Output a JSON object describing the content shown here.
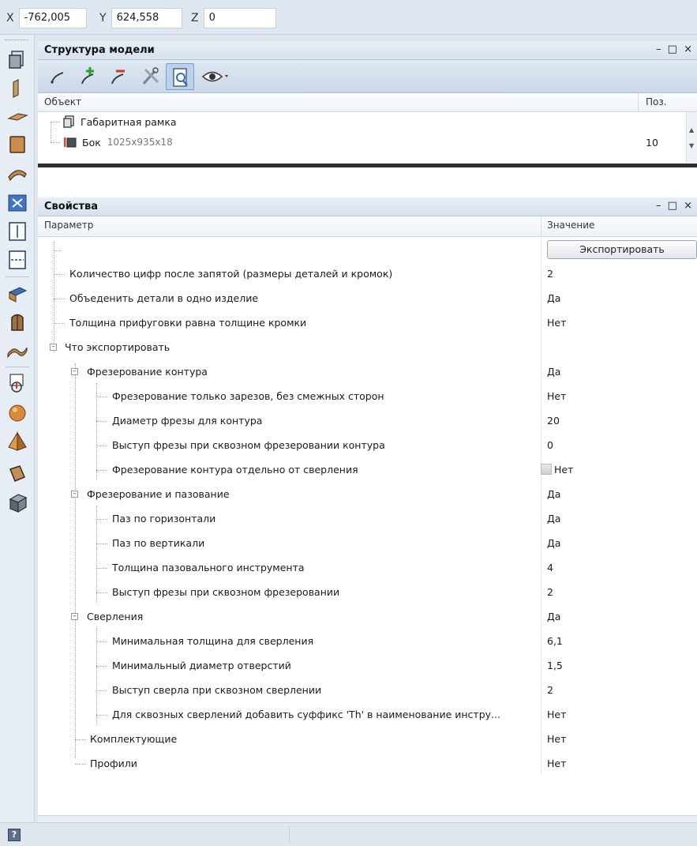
{
  "coords": {
    "x_label": "X",
    "x_value": "-762,005",
    "y_label": "Y",
    "y_value": "624,558",
    "z_label": "Z",
    "z_value": "0"
  },
  "structure_panel": {
    "title": "Структура модели",
    "controls": "– □ ×",
    "col_object": "Объект",
    "col_pos": "Поз.",
    "rows": [
      {
        "name": "Габаритная рамка",
        "dims": "",
        "pos": ""
      },
      {
        "name": "Бок",
        "dims": "1025x935x18",
        "pos": "10"
      }
    ]
  },
  "properties_panel": {
    "title": "Свойства",
    "controls": "– □ ×",
    "col_param": "Параметр",
    "col_value": "Значение",
    "export_button": "Экспортировать",
    "rows": [
      {
        "name": "Количество цифр после запятой (размеры деталей и кромок)",
        "value": "2"
      },
      {
        "name": "Объеденить детали в одно изделие",
        "value": "Да"
      },
      {
        "name": "Толщина прифуговки равна толщине кромки",
        "value": "Нет"
      },
      {
        "name": "Что экспортировать",
        "value": ""
      },
      {
        "name": "Фрезерование контура",
        "value": "Да"
      },
      {
        "name": "Фрезерование только зарезов, без смежных сторон",
        "value": "Нет"
      },
      {
        "name": "Диаметр фрезы для контура",
        "value": "20"
      },
      {
        "name": "Выступ фрезы при сквозном фрезеровании контура",
        "value": "0"
      },
      {
        "name": "Фрезерование контура отдельно от сверления",
        "value": "Нет"
      },
      {
        "name": "Фрезерование и пазование",
        "value": "Да"
      },
      {
        "name": "Паз по горизонтали",
        "value": "Да"
      },
      {
        "name": "Паз по вертикали",
        "value": "Да"
      },
      {
        "name": "Толщина пазовального инструмента",
        "value": "4"
      },
      {
        "name": "Выступ фрезы при сквозном фрезеровании",
        "value": "2"
      },
      {
        "name": "Сверления",
        "value": "Да"
      },
      {
        "name": "Минимальная толщина для сверления",
        "value": "6,1"
      },
      {
        "name": "Минимальный диаметр отверстий",
        "value": "1,5"
      },
      {
        "name": "Выступ сверла при сквозном сверлении",
        "value": "2"
      },
      {
        "name": "Для сквозных сверлений добавить суффикс 'Th' в наименование инстру...",
        "value": "Нет"
      },
      {
        "name": "Комплектующие",
        "value": "Нет"
      },
      {
        "name": "Профили",
        "value": "Нет"
      }
    ]
  },
  "status": {
    "help_icon_label": "?"
  },
  "colors": {
    "accent": "#f08a3c",
    "panel_header": "#d7e1ee",
    "toolbar": "#e7edf5"
  }
}
